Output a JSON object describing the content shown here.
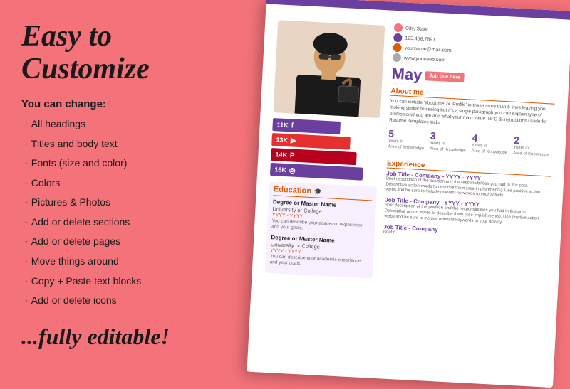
{
  "header": {
    "main_title_line1": "Easy to",
    "main_title_line2": "Customize",
    "fully_editable": "...fully editable!"
  },
  "left_list": {
    "heading": "You can change:",
    "items": [
      "All headings",
      "Titles and body text",
      "Fonts (size and color)",
      "Colors",
      "Pictures & Photos",
      "Add or delete sections",
      "Add or delete pages",
      "Move things around",
      "Copy + Paste text blocks",
      "Add or delete icons"
    ]
  },
  "resume": {
    "contact": {
      "location": "City, State",
      "phone": "123.456.7891",
      "email": "yourname@mail.com",
      "website": "www.yourweb.com"
    },
    "name": "May",
    "job_title": "Job title here",
    "about_heading": "About me",
    "about_text": "You can include 'about me' or 'Profile' in these more than 5 lines leaving you looking similar to seeing but it's a single paragraph you can explain type of professional you are and what your main value INFO & Instructions Guide for Resume Templates inclu",
    "social_bars": [
      {
        "label": "11K",
        "network": "f",
        "color": "purple"
      },
      {
        "label": "13K",
        "network": "yt",
        "color": "red"
      },
      {
        "label": "14K",
        "network": "pin",
        "color": "darkred"
      },
      {
        "label": "16K",
        "network": "ig",
        "color": "purple"
      }
    ],
    "skills": [
      {
        "years": "5",
        "label": "Years in\nArea of Knowledge"
      },
      {
        "years": "3",
        "label": "Years in\nArea of Knowledge"
      },
      {
        "years": "4",
        "label": "Years in\nArea of Knowledge"
      },
      {
        "years": "2",
        "label": "Years in\nArea of Knowledge"
      }
    ],
    "education_heading": "Education",
    "education_entries": [
      {
        "degree": "Degree or Master Name",
        "school": "University or College",
        "years": "YYYY - YYYY",
        "desc": "You can describe your academic experience and your goals."
      },
      {
        "degree": "Degree or Master Name",
        "school": "University or College",
        "years": "YYYY - YYYY",
        "desc": "You can describe your academic experience and your goals."
      }
    ],
    "experience_heading": "Experience",
    "experience_entries": [
      {
        "title": "Job Title - Company - YYYY - YYYY",
        "desc": "Brief description of the position and the responsibilities you had in this post. Descriptive action words to describe them (see Implishments). Use positive action verbs and be sure to include relevant keywords to your activity."
      },
      {
        "title": "Job Title - Company - YYYY - YYYY",
        "desc": "Brief description of the position and the responsibilities you had in this post. Descriptive action words to describe them (see Implishments). Use positive action verbs and be sure to include relevant keywords to your activity."
      },
      {
        "title": "Job Title - Company",
        "desc": "Brief r"
      }
    ]
  },
  "colors": {
    "background": "#f4737a",
    "purple": "#6b3fa0",
    "orange": "#e05a00",
    "red": "#e63030",
    "darkred": "#b8001f",
    "pink": "#f4737a"
  }
}
